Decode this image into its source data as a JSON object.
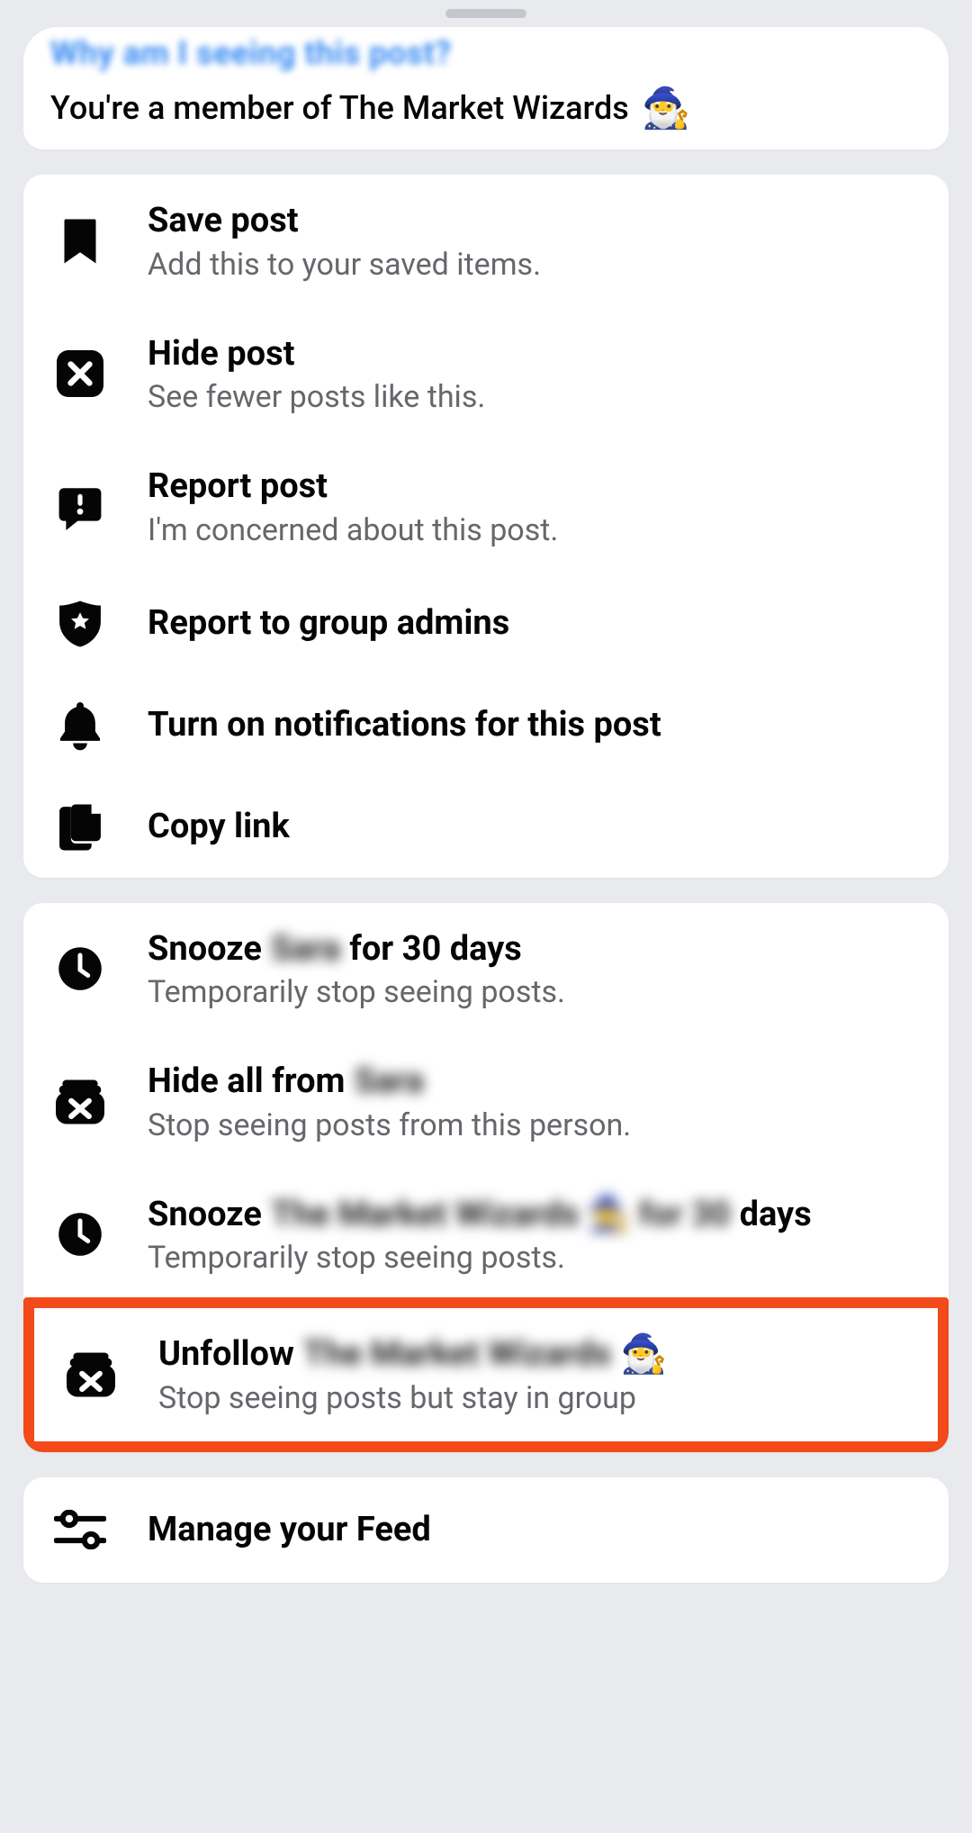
{
  "sheet": {
    "why_link_text": "Why am I seeing this post?",
    "member_text": "You're a member of The Market Wizards"
  },
  "group1": {
    "save": {
      "title": "Save post",
      "sub": "Add this to your saved items."
    },
    "hide": {
      "title": "Hide post",
      "sub": "See fewer posts like this."
    },
    "report": {
      "title": "Report post",
      "sub": "I'm concerned about this post."
    },
    "report_admins": {
      "title": "Report to group admins"
    },
    "notifications": {
      "title": "Turn on notifications for this post"
    },
    "copy_link": {
      "title": "Copy link"
    }
  },
  "group2": {
    "snooze_person": {
      "prefix": "Snooze",
      "name_blurred": "Sara",
      "suffix": "for 30 days",
      "sub": "Temporarily stop seeing posts."
    },
    "hide_all_person": {
      "prefix": "Hide all from",
      "name_blurred": "Sara",
      "sub": "Stop seeing posts from this person."
    },
    "snooze_group": {
      "prefix": "Snooze",
      "name_blurred": "The Market Wizards 🧙 for 30",
      "suffix": "days",
      "sub": "Temporarily stop seeing posts."
    },
    "unfollow_group": {
      "prefix": "Unfollow",
      "name_blurred": "The Market Wizards",
      "sub": "Stop seeing posts but stay in group"
    }
  },
  "group3": {
    "manage_feed": {
      "title": "Manage your Feed"
    }
  }
}
